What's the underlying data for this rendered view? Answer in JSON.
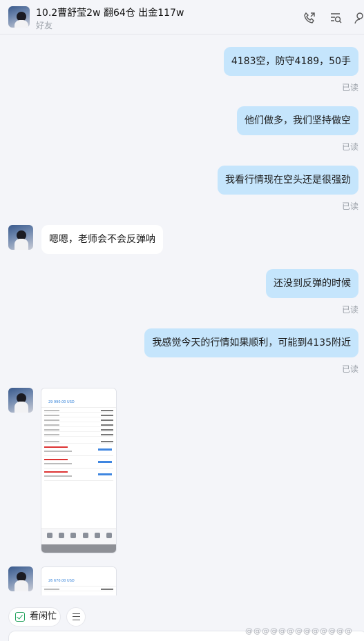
{
  "header": {
    "title": "10.2曹舒莹2w 翻64仓 出金117w",
    "subtitle": "好友",
    "icons": [
      "call-icon",
      "search-history-icon",
      "contact-icon"
    ]
  },
  "messages": [
    {
      "side": "out",
      "text": "4183空，防守4189，50手",
      "status": "已读"
    },
    {
      "side": "out",
      "text": "他们做多，我们坚持做空",
      "status": "已读"
    },
    {
      "side": "out",
      "text": "我看行情现在空头还是很强劲",
      "status": "已读"
    },
    {
      "side": "in",
      "text": "嗯嗯，老师会不会反弹呐"
    },
    {
      "side": "out",
      "text": "还没到反弹的时候",
      "status": "已读"
    },
    {
      "side": "out",
      "text": "我感觉今天的行情如果顺利，可能到4135附近",
      "status": "已读"
    },
    {
      "side": "in",
      "type": "image",
      "caption": "29 990.00 USD"
    },
    {
      "side": "in",
      "type": "image",
      "caption": "26 670.00 USD"
    }
  ],
  "quick_actions": {
    "busy_label": "看闲忙",
    "menu_icon": "menu-icon"
  },
  "watermark": "@@@@@@@@@@@@@"
}
